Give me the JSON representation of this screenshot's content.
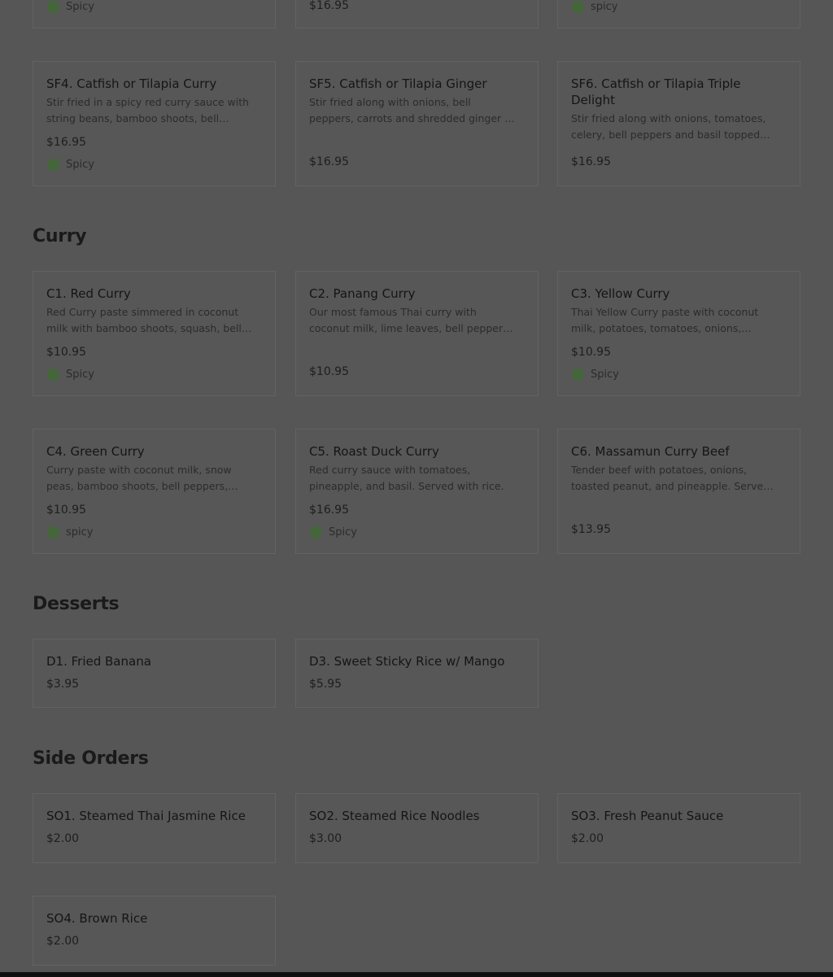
{
  "colors": {
    "badge_green": "#3f6b32",
    "background": "#565656"
  },
  "top_partial": {
    "col1_badge": "Spicy",
    "col2_price": "$16.95",
    "col3_badge": "spicy"
  },
  "sections": {
    "seafood": {
      "items": [
        {
          "title": "SF4. Catfish or Tilapia Curry",
          "desc": "Stir fried in a spicy red curry sauce with string beans, bamboo shoots, bell peppers",
          "price": "$16.95",
          "badge": "Spicy"
        },
        {
          "title": "SF5. Catfish or Tilapia Ginger",
          "desc": "Stir fried along with onions, bell peppers, carrots and shredded ginger in our special sauce",
          "price": "$16.95"
        },
        {
          "title": "SF6. Catfish or Tilapia Triple Delight",
          "desc": "Stir fried along with onions, tomatoes, celery, bell peppers and basil topped with",
          "price": "$16.95"
        }
      ]
    },
    "curry": {
      "heading": "Curry",
      "items": [
        {
          "title": "C1. Red Curry",
          "desc": "Red Curry paste simmered in coconut milk with bamboo shoots, squash, bell peppers",
          "price": "$10.95",
          "badge": "Spicy"
        },
        {
          "title": "C2. Panang Curry",
          "desc": "Our most famous Thai curry with coconut milk, lime leaves, bell peppers, and more",
          "price": "$10.95"
        },
        {
          "title": "C3. Yellow Curry",
          "desc": "Thai Yellow Curry paste with coconut milk, potatoes, tomatoes, onions, carrots",
          "price": "$10.95",
          "badge": "Spicy"
        },
        {
          "title": "C4. Green Curry",
          "desc": "Curry paste with coconut milk, snow peas, bamboo shoots, bell peppers, basil",
          "price": "$10.95",
          "badge": "spicy"
        },
        {
          "title": "C5. Roast Duck Curry",
          "desc": "Red curry sauce with tomatoes, pineapple, and basil. Served with rice.",
          "price": "$16.95",
          "badge": "Spicy"
        },
        {
          "title": "C6. Massamun Curry Beef",
          "desc": "Tender beef with potatoes, onions, toasted peanut, and pineapple. Served with rice.",
          "price": "$13.95"
        }
      ]
    },
    "desserts": {
      "heading": "Desserts",
      "items": [
        {
          "title": "D1. Fried Banana",
          "price": "$3.95"
        },
        {
          "title": "D3. Sweet Sticky Rice w/ Mango",
          "price": "$5.95"
        }
      ]
    },
    "side_orders": {
      "heading": "Side Orders",
      "items": [
        {
          "title": "SO1. Steamed Thai Jasmine Rice",
          "price": "$2.00"
        },
        {
          "title": "SO2. Steamed Rice Noodles",
          "price": "$3.00"
        },
        {
          "title": "SO3. Fresh Peanut Sauce",
          "price": "$2.00"
        },
        {
          "title": "SO4. Brown Rice",
          "price": "$2.00"
        }
      ]
    }
  }
}
